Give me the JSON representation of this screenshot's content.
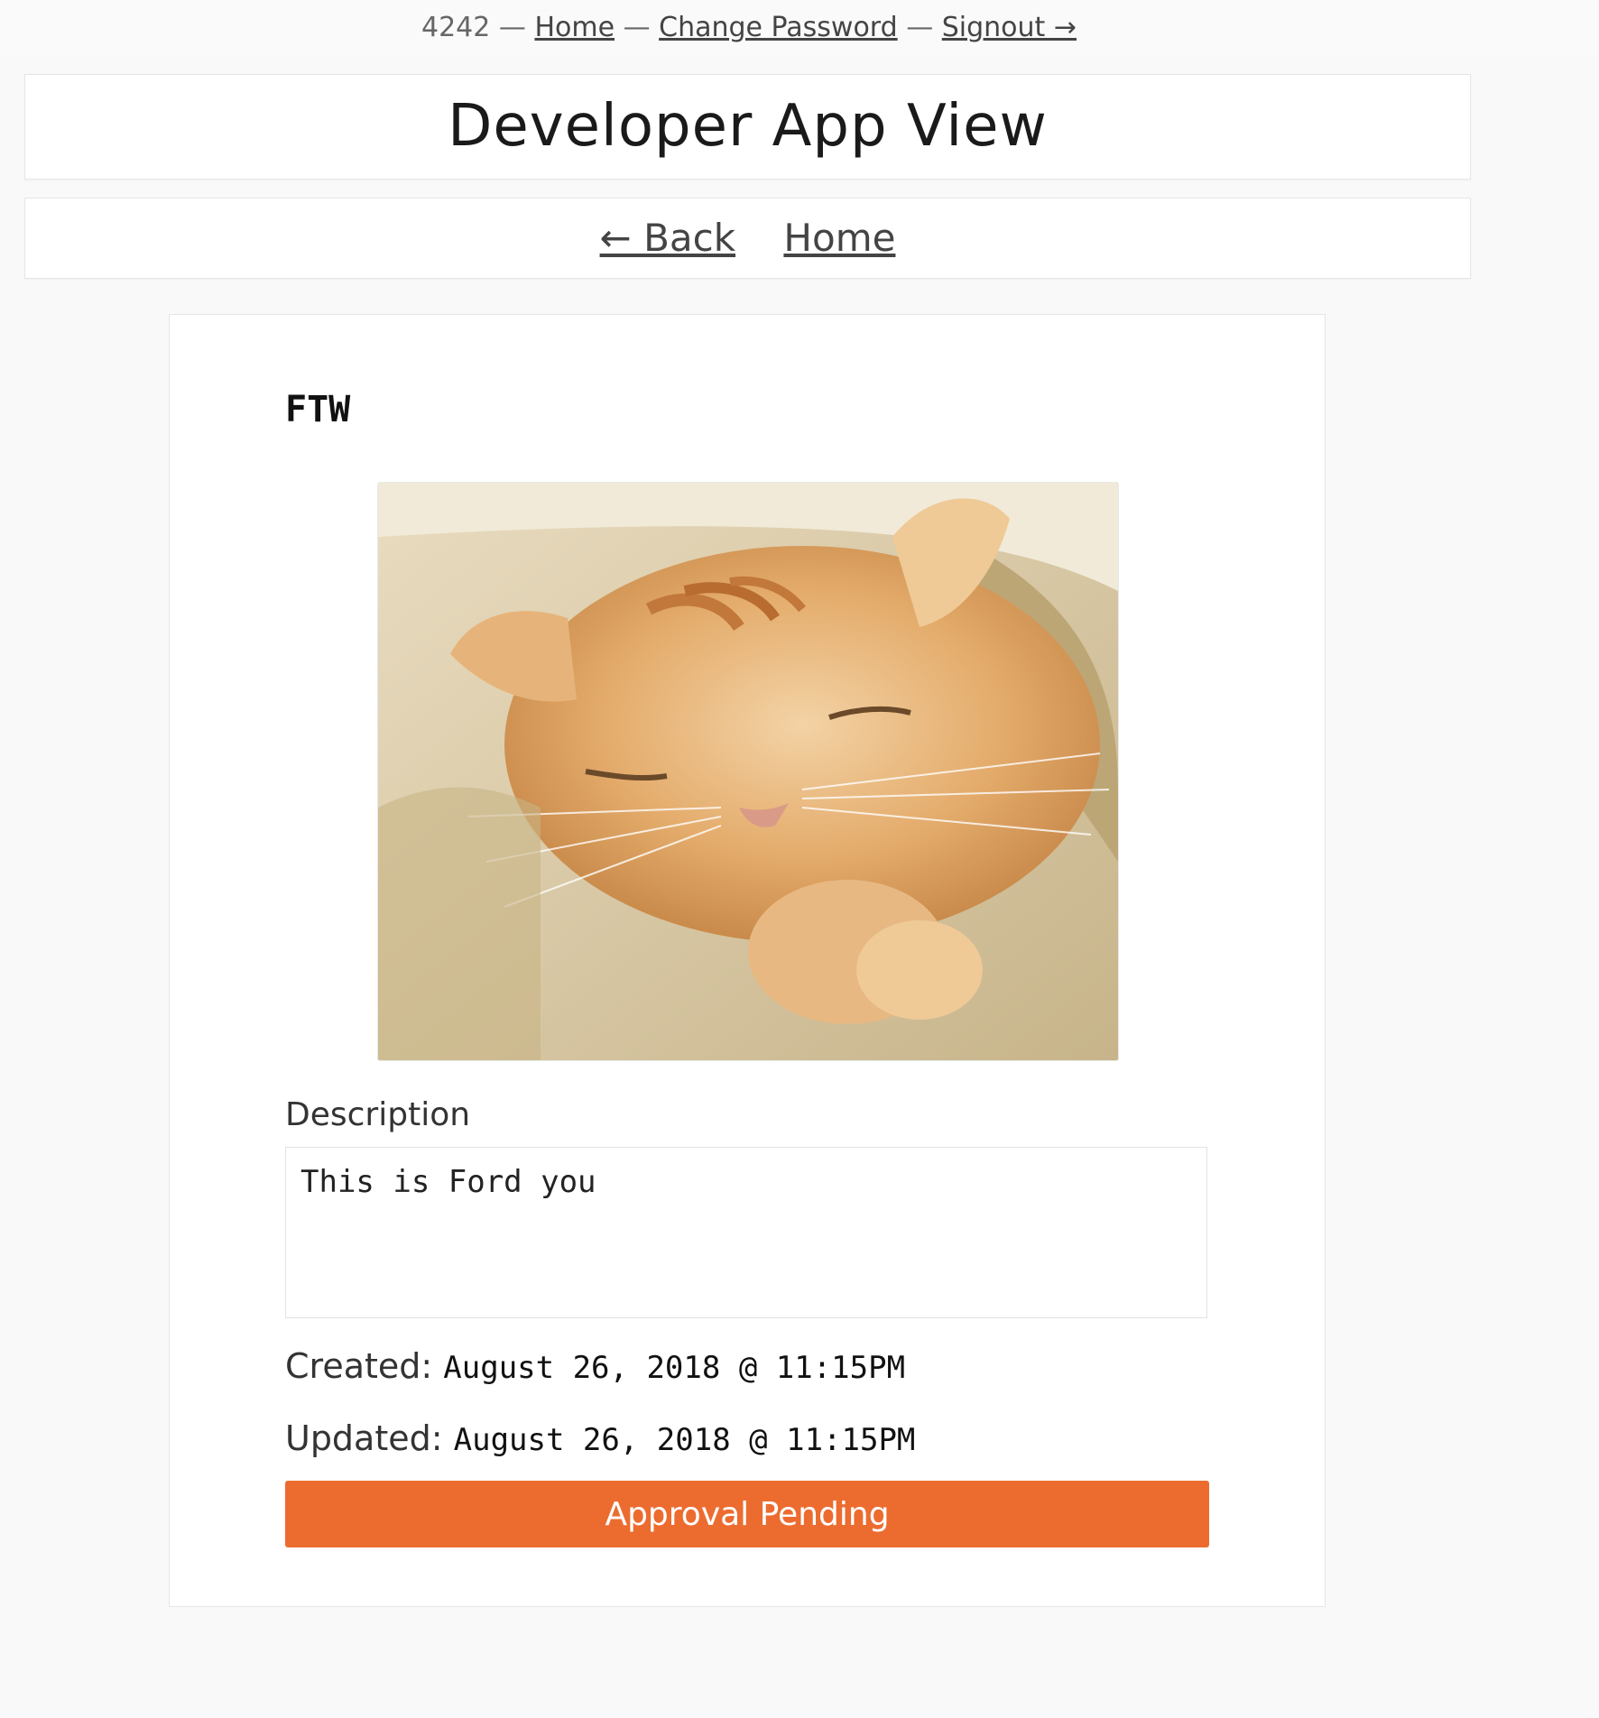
{
  "header": {
    "user_id": "4242",
    "separator": "—",
    "home_link": "Home",
    "change_password_link": "Change Password",
    "signout_link": "Signout →"
  },
  "page": {
    "title": "Developer App View"
  },
  "nav": {
    "back_link": "← Back",
    "home_link": "Home"
  },
  "app": {
    "name": "FTW",
    "image_icon": "cat-photo",
    "description_label": "Description",
    "description": "This is Ford you",
    "created_label": "Created:",
    "created_value": "August 26, 2018 @ 11:15PM",
    "updated_label": "Updated:",
    "updated_value": "August 26, 2018 @ 11:15PM",
    "status_button": "Approval Pending"
  },
  "colors": {
    "status_button": "#ec6c30",
    "background": "#f9f9f9"
  }
}
